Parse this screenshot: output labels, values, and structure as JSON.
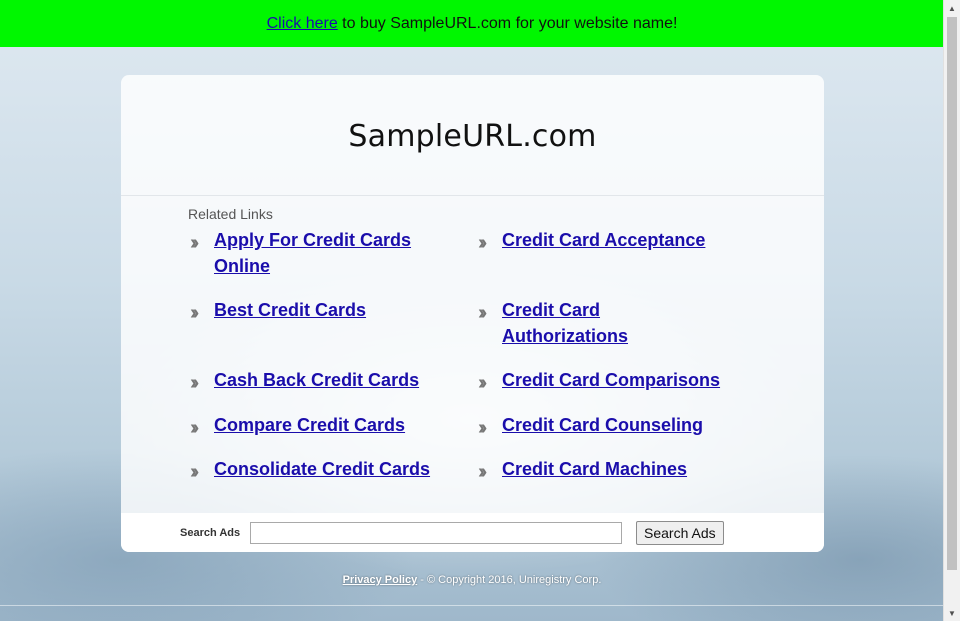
{
  "promo_bar": {
    "link_label": "Click here",
    "text": " to buy SampleURL.com for your website name!"
  },
  "site": {
    "title": "SampleURL.com"
  },
  "related": {
    "heading": "Related Links",
    "left_links": [
      "Apply For Credit Cards Online",
      "Best Credit Cards",
      "Cash Back Credit Cards",
      "Compare Credit Cards",
      "Consolidate Credit Cards"
    ],
    "right_links": [
      "Credit Card Acceptance",
      "Credit Card Authorizations",
      "Credit Card Comparisons",
      "Credit Card Counseling",
      "Credit Card Machines"
    ],
    "bullet_icon": "double-chevron-right-icon"
  },
  "search": {
    "label": "Search Ads",
    "input_value": "",
    "button_label": "Search Ads"
  },
  "footer": {
    "privacy_label": "Privacy Policy",
    "copyright": " - © Copyright 2016, Uniregistry Corp."
  },
  "colors": {
    "promo_bar": "#00f700",
    "link": "#1a0dab"
  }
}
